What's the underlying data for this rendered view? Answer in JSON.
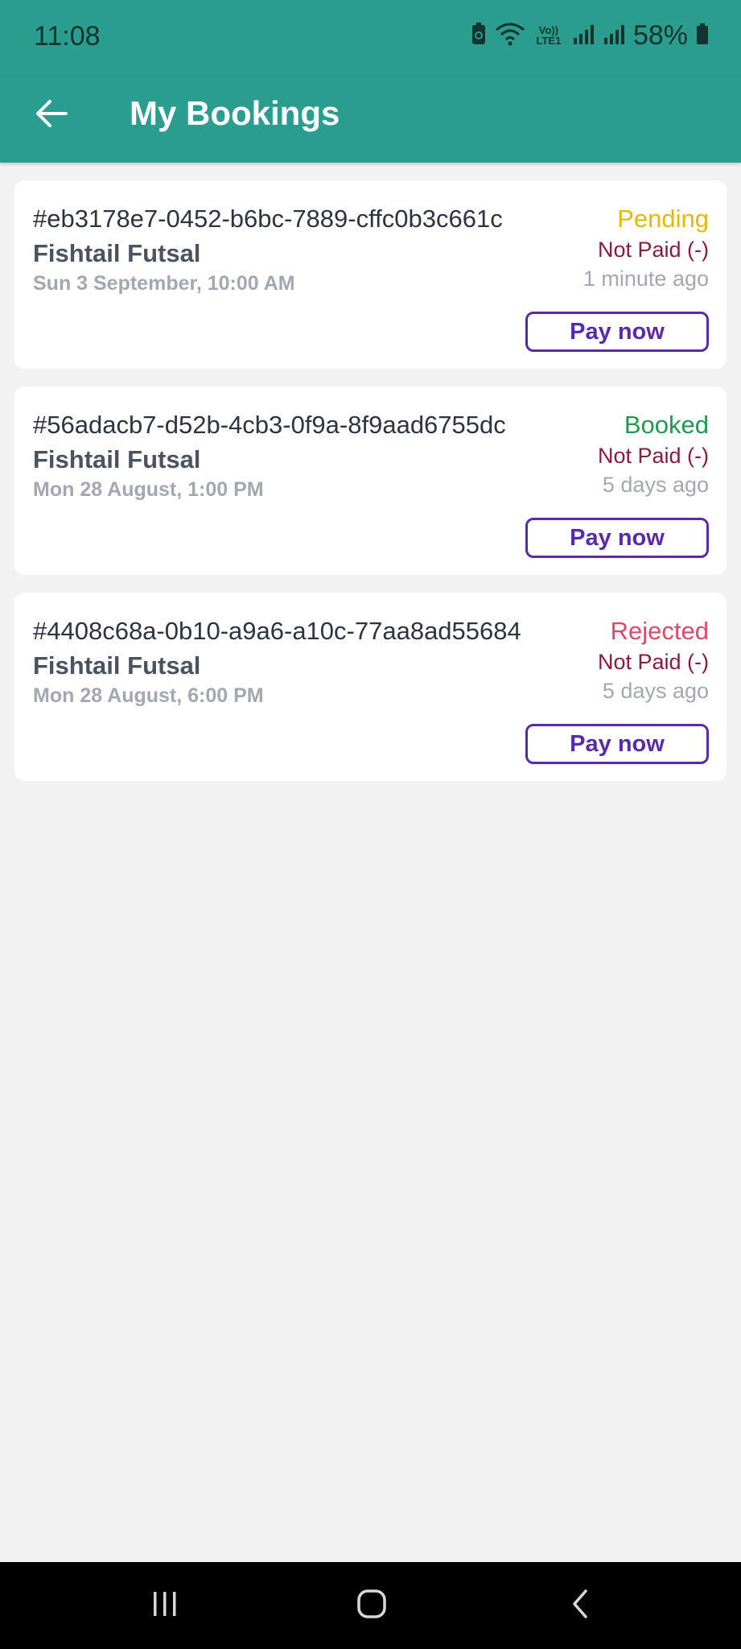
{
  "status_bar": {
    "time": "11:08",
    "battery": "58%",
    "signal_label": "Vo)) LTE1",
    "icons": [
      "battery-saver-icon",
      "wifi-icon",
      "volte-icon",
      "signal-icon",
      "signal-icon",
      "battery-icon"
    ]
  },
  "app_bar": {
    "back_icon": "arrow-left-icon",
    "title": "My Bookings",
    "background": "#2a9d8f"
  },
  "bookings": [
    {
      "id": "#eb3178e7-0452-b6bc-7889-cffc0b3c661c",
      "venue": "Fishtail Futsal",
      "datetime": "Sun 3 September, 10:00 AM",
      "status": "Pending",
      "status_color": "#e6b800",
      "payment": "Not Paid (-)",
      "relative_time": "1 minute ago",
      "action": "Pay now"
    },
    {
      "id": "#56adacb7-d52b-4cb3-0f9a-8f9aad6755dc",
      "venue": "Fishtail Futsal",
      "datetime": "Mon 28 August, 1:00 PM",
      "status": "Booked",
      "status_color": "#1e9b4f",
      "payment": "Not Paid (-)",
      "relative_time": "5 days ago",
      "action": "Pay now"
    },
    {
      "id": "#4408c68a-0b10-a9a6-a10c-77aa8ad55684",
      "venue": "Fishtail Futsal",
      "datetime": "Mon 28 August, 6:00 PM",
      "status": "Rejected",
      "status_color": "#e0486a",
      "payment": "Not Paid (-)",
      "relative_time": "5 days ago",
      "action": "Pay now"
    }
  ],
  "nav_bar": {
    "icons": [
      "recent-apps-icon",
      "home-icon",
      "back-icon"
    ]
  }
}
